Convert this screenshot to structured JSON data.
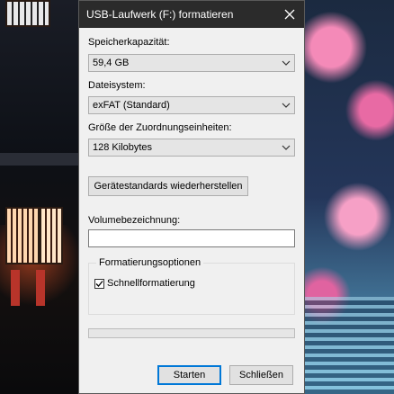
{
  "dialog": {
    "title": "USB-Laufwerk (F:) formatieren",
    "capacity": {
      "label": "Speicherkapazität:",
      "value": "59,4 GB"
    },
    "filesystem": {
      "label": "Dateisystem:",
      "value": "exFAT (Standard)"
    },
    "allocation": {
      "label": "Größe der Zuordnungseinheiten:",
      "value": "128 Kilobytes"
    },
    "restore_defaults_label": "Gerätestandards wiederherstellen",
    "volume": {
      "label": "Volumebezeichnung:",
      "value": ""
    },
    "format_options": {
      "group_label": "Formatierungsoptionen",
      "quick_format_label": "Schnellformatierung",
      "quick_format_checked": true
    },
    "progress": 0,
    "start_label": "Starten",
    "close_label": "Schließen"
  },
  "colors": {
    "titlebar": "#2b2b2b",
    "dialog_bg": "#f0f0f0",
    "accent": "#0078d7"
  },
  "icons": [
    "close-icon",
    "chevron-down-icon",
    "checkmark-icon"
  ]
}
